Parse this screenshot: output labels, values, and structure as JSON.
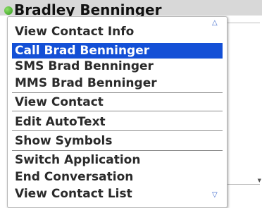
{
  "header": {
    "contact_name": "Bradley Benninger",
    "presence_color": "#3aa820"
  },
  "menu": {
    "items": [
      {
        "label": "View Contact Info",
        "selected": false
      },
      {
        "label": "Call Brad Benninger",
        "selected": true
      },
      {
        "label": "SMS Brad Benninger",
        "selected": false
      },
      {
        "label": "MMS Brad Benninger",
        "selected": false
      },
      {
        "label": "View Contact",
        "selected": false
      },
      {
        "label": "Edit AutoText",
        "selected": false
      },
      {
        "label": "Show Symbols",
        "selected": false
      },
      {
        "label": "Switch Application",
        "selected": false
      },
      {
        "label": "End Conversation",
        "selected": false
      },
      {
        "label": "View Contact List",
        "selected": false
      }
    ],
    "scroll_up_icon": "chevron-up-icon",
    "scroll_down_icon": "chevron-down-icon"
  },
  "colors": {
    "selection": "#1450d6",
    "text": "#2a2a2a"
  }
}
